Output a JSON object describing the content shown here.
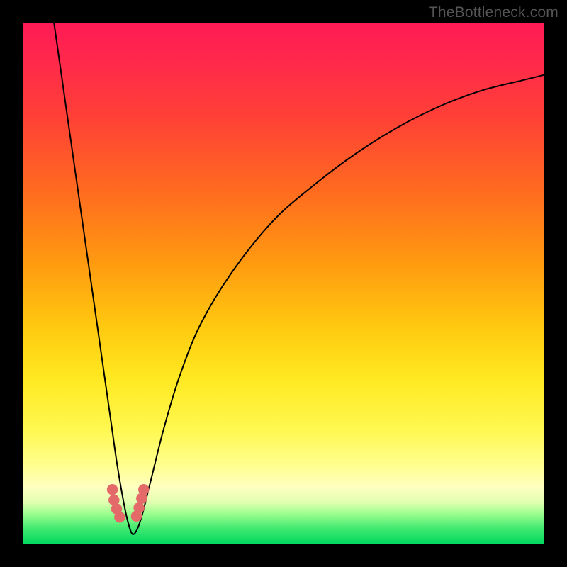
{
  "watermark": {
    "text": "TheBottleneck.com"
  },
  "colors": {
    "frame": "#000000",
    "curve": "#000000",
    "marker": "#e46a6a",
    "bg_top": "#ff1a55",
    "bg_bottom": "#00d860"
  },
  "chart_data": {
    "type": "line",
    "title": "",
    "xlabel": "",
    "ylabel": "",
    "xlim": [
      0,
      100
    ],
    "ylim": [
      0,
      100
    ],
    "grid": false,
    "legend": false,
    "note": "x and y in 0–100 of plot area; origin at top-left; curve is the bottleneck V reaching the baseline near x≈20.",
    "series": [
      {
        "name": "bottleneck-curve",
        "x": [
          6,
          8,
          10,
          12,
          14,
          15,
          16,
          17,
          18,
          19,
          20,
          21,
          22,
          23,
          24,
          25,
          27,
          30,
          34,
          40,
          48,
          56,
          64,
          72,
          80,
          88,
          96,
          100
        ],
        "y": [
          0,
          14,
          28,
          42,
          56,
          63,
          70,
          77,
          84,
          90,
          95,
          98,
          97,
          94,
          90,
          86,
          78,
          68,
          58,
          48,
          38,
          31,
          25,
          20,
          16,
          13,
          11,
          10
        ]
      }
    ],
    "markers": [
      {
        "x": 17.2,
        "y": 89.5
      },
      {
        "x": 17.5,
        "y": 91.5
      },
      {
        "x": 18.0,
        "y": 93.2
      },
      {
        "x": 18.6,
        "y": 94.8
      },
      {
        "x": 21.8,
        "y": 94.6
      },
      {
        "x": 22.3,
        "y": 93.0
      },
      {
        "x": 22.8,
        "y": 91.2
      },
      {
        "x": 23.2,
        "y": 89.5
      }
    ]
  }
}
